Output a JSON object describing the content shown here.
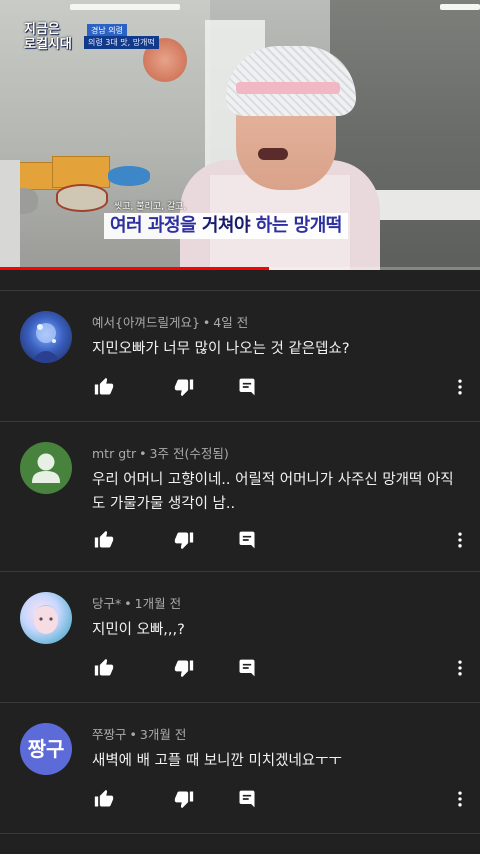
{
  "video": {
    "show_logo_line1": "지금은",
    "show_logo_line2": "로컬시대",
    "location_tag": "경남 의령",
    "location_sub": "의령 3대 맛, 망개떡",
    "caption_small": "씻고, 불리고, 갈고,",
    "caption_part1": "여러 과정",
    "caption_part2": "을 ",
    "caption_part3": "거쳐야",
    "caption_part4": " 하는 망개떡",
    "progress_fraction": 0.56,
    "progress_color": "#ff0000"
  },
  "icons": {
    "like": "thumb-up-icon",
    "dislike": "thumb-down-icon",
    "reply": "comment-reply-icon",
    "more": "more-vertical-icon",
    "default_avatar": "person-icon"
  },
  "comments": [
    {
      "author": "예서{아껴드릴게요}",
      "dot": "•",
      "time": "4일 전",
      "text": "지민오빠가 너무 많이 나오는 것 같은뎁쇼?",
      "avatar_color": "#3a5fbf"
    },
    {
      "author": "mtr gtr",
      "dot": "•",
      "time": "3주 전(수정됨)",
      "text": "우리 어머니 고향이네.. 어릴적 어머니가 사주신 망개떡 아직도 가물가물 생각이 남..",
      "avatar_color": "#47833c"
    },
    {
      "author": "당구*",
      "dot": "•",
      "time": "1개월 전",
      "text": "지민이 오빠,,,?",
      "avatar_color": "#8fc0e0"
    },
    {
      "author": "쭈짱구",
      "dot": "•",
      "time": "3개월 전",
      "text": "새벽에 배 고플 때 보니깐 미치겠네요ㅜㅜ",
      "avatar_initials": "짱구",
      "avatar_color": "#5c6bd8"
    }
  ]
}
